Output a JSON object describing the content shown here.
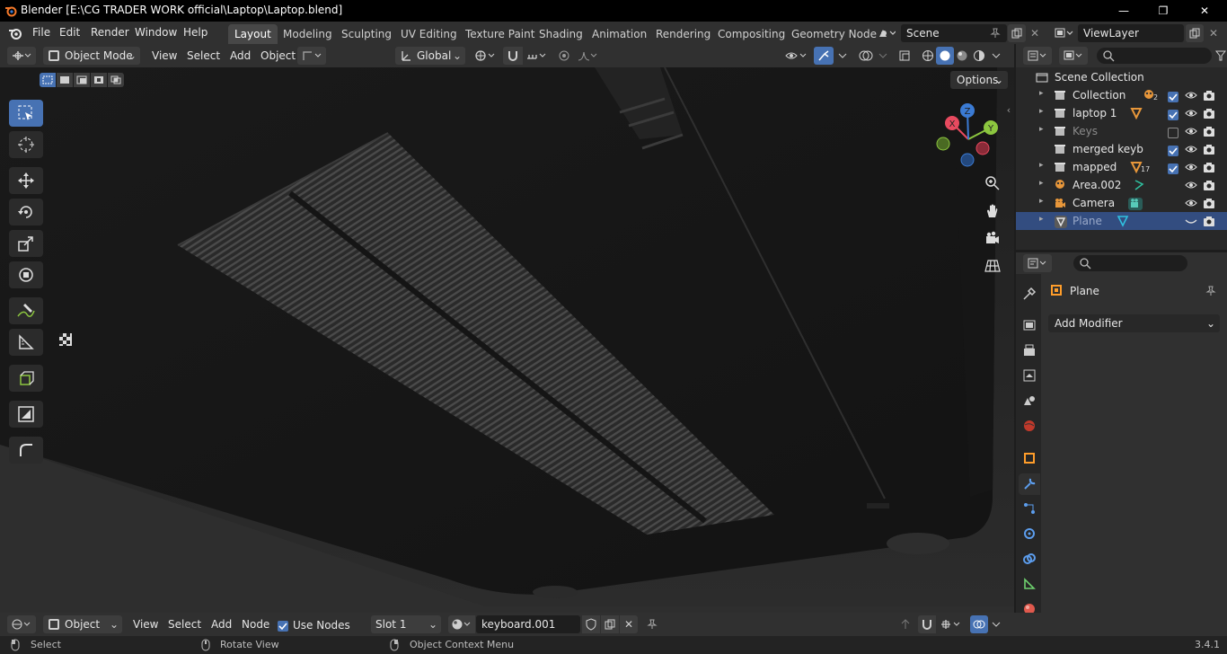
{
  "window": {
    "title": "Blender [E:\\CG TRADER WORK official\\Laptop\\Laptop.blend]",
    "minimize": "—",
    "maximize": "❐",
    "close": "✕"
  },
  "menu": [
    "File",
    "Edit",
    "Render",
    "Window",
    "Help"
  ],
  "workspaces": [
    "Layout",
    "Modeling",
    "Sculpting",
    "UV Editing",
    "Texture Paint",
    "Shading",
    "Animation",
    "Rendering",
    "Compositing",
    "Geometry Node"
  ],
  "active_workspace": "Layout",
  "scene": {
    "name": "Scene"
  },
  "viewlayer": {
    "name": "ViewLayer"
  },
  "viewport_header": {
    "mode": "Object Mode",
    "menus": [
      "View",
      "Select",
      "Add",
      "Object"
    ],
    "orientation": "Global",
    "options": "Options"
  },
  "outliner": {
    "root": "Scene Collection",
    "items": [
      {
        "label": "Collection",
        "badge": "2",
        "visible": true,
        "checked": true,
        "dim": false
      },
      {
        "label": "laptop 1",
        "badge": "",
        "visible": true,
        "checked": true,
        "dim": false
      },
      {
        "label": "Keys",
        "badge": "",
        "visible": true,
        "checked": false,
        "dim": true
      },
      {
        "label": "merged keyb",
        "badge": "",
        "visible": true,
        "checked": true,
        "dim": false
      },
      {
        "label": "mapped",
        "badge": "17",
        "visible": true,
        "checked": true,
        "dim": false
      },
      {
        "label": "Area.002",
        "badge": "",
        "visible": true,
        "checked": null,
        "dim": false
      },
      {
        "label": "Camera",
        "badge": "",
        "visible": true,
        "checked": null,
        "dim": false
      },
      {
        "label": "Plane",
        "badge": "",
        "visible": false,
        "checked": null,
        "dim": false,
        "selected": true
      }
    ]
  },
  "properties": {
    "object_name": "Plane",
    "add_modifier": "Add Modifier"
  },
  "bottom_editor": {
    "mode": "Object",
    "menus": [
      "View",
      "Select",
      "Add",
      "Node"
    ],
    "use_nodes_label": "Use Nodes",
    "use_nodes": true,
    "slot": "Slot 1",
    "material": "keyboard.001"
  },
  "status": {
    "select": "Select",
    "rotate": "Rotate View",
    "context": "Object Context Menu",
    "version": "3.4.1"
  },
  "colors": {
    "accent": "#4772b3",
    "selected_row": "#334d80",
    "gizmo_x": "#e84a5f",
    "gizmo_y": "#8cc63f",
    "gizmo_z": "#3b7bd4"
  }
}
